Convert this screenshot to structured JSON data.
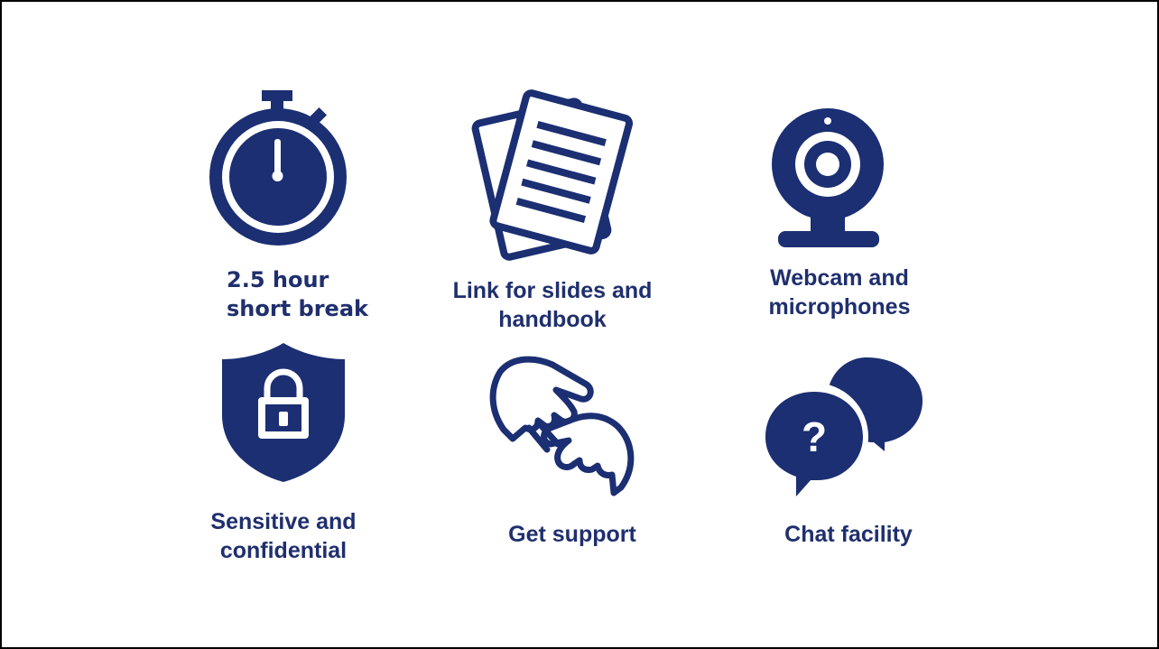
{
  "colors": {
    "icon_primary": "#1b2f72",
    "text_primary": "#1f2f6e",
    "background": "#ffffff",
    "border": "#000000"
  },
  "items": [
    {
      "icon": "stopwatch-icon",
      "lines": [
        "2.5 hour",
        "short break"
      ]
    },
    {
      "icon": "documents-icon",
      "lines": [
        "Link for slides and",
        "handbook"
      ]
    },
    {
      "icon": "webcam-icon",
      "lines": [
        "Webcam and",
        "microphones"
      ]
    },
    {
      "icon": "shield-lock-icon",
      "lines": [
        "Sensitive and",
        "confidential"
      ]
    },
    {
      "icon": "helping-hands-icon",
      "lines": [
        "Get support"
      ]
    },
    {
      "icon": "chat-bubbles-icon",
      "lines": [
        "Chat facility"
      ]
    }
  ]
}
